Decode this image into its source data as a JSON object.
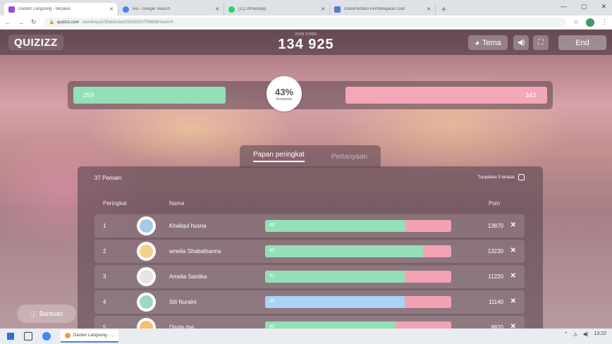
{
  "browser": {
    "tabs": [
      {
        "title": "Dasbor Langsung - berjalan",
        "color": "#9b4fd0",
        "active": true
      },
      {
        "title": "wa - Google Search",
        "color": "#4285f4",
        "active": false
      },
      {
        "title": "(11) WhatsApp",
        "color": "#25d366",
        "active": false
      },
      {
        "title": "Dokumentasi Pembelajaran Dari",
        "color": "#5a78c8",
        "active": false
      }
    ],
    "url_host": "quizizz.com",
    "url_path": "/admin/quiz/5fab6c5eb25b55001f7b88b6/startV4"
  },
  "header": {
    "logo": "QUIZIZZ",
    "join_label": "JOIN CODE",
    "join_code": "134 925",
    "theme_label": "Tema",
    "end_label": "End"
  },
  "accuracy": {
    "correct": "259",
    "incorrect": "343",
    "percent": "43%",
    "percent_label": "Ketepatan",
    "fraction": 0.43
  },
  "leaderboard": {
    "tabs": [
      "Papan peringkat",
      "Pertanyaan"
    ],
    "players_count": "37 Pemain",
    "top5_label": "Tunjukkan 5 teratas",
    "columns": {
      "rank": "Peringkat",
      "name": "Nama",
      "points": "Poin"
    },
    "rows": [
      {
        "rank": "1",
        "name": "Khaliqul husna",
        "bar_label": "40",
        "fill": 0.75,
        "fill_color": "#93e0b6",
        "points": "13870",
        "avatar": "#a9c8e8"
      },
      {
        "rank": "2",
        "name": "amelia Shabathanna",
        "bar_label": "42",
        "fill": 0.85,
        "fill_color": "#93e0b6",
        "points": "13230",
        "avatar": "#f4d08a"
      },
      {
        "rank": "3",
        "name": "Amelia Santika",
        "bar_label": "41",
        "fill": 0.75,
        "fill_color": "#93e0b6",
        "points": "11220",
        "avatar": "#e5e5e5"
      },
      {
        "rank": "4",
        "name": "Siti Nuraini",
        "bar_label": "45",
        "fill": 0.75,
        "fill_color": "#a9d4f5",
        "points": "11140",
        "avatar": "#9bd7c8"
      },
      {
        "rank": "5",
        "name": "Dinda dwi",
        "bar_label": "42",
        "fill": 0.7,
        "fill_color": "#93e0b6",
        "points": "9820",
        "avatar": "#f2c26b"
      }
    ]
  },
  "help_label": "Bantuan",
  "taskbar": {
    "app_label": "Dasbor Langsung - ...",
    "time": "13:22"
  }
}
